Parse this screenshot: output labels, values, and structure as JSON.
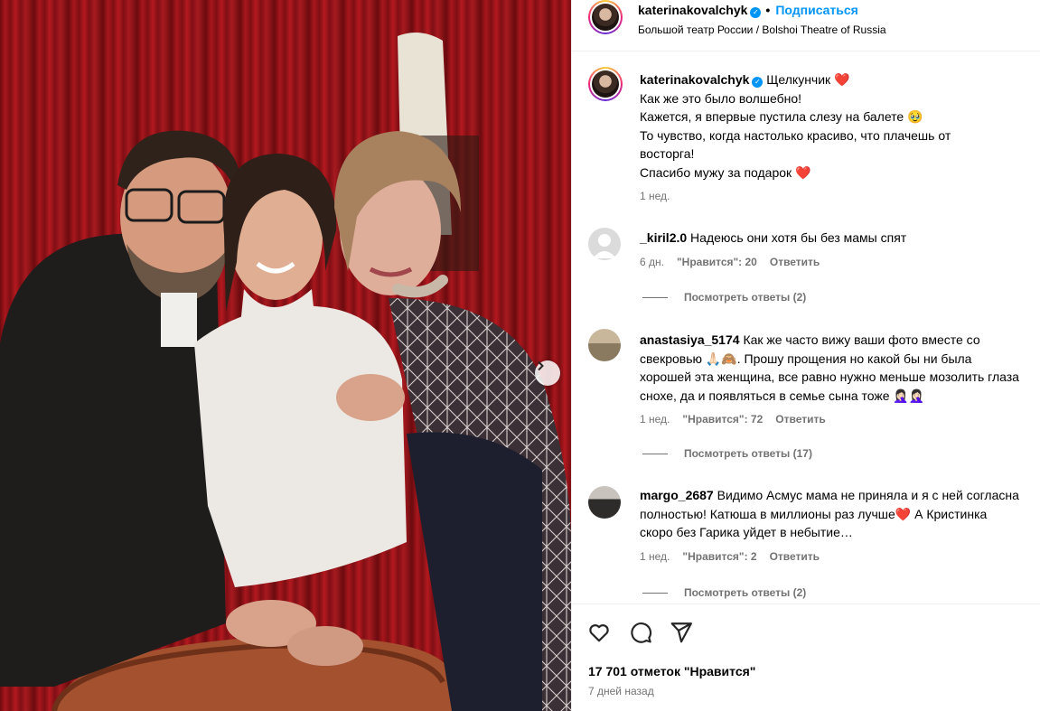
{
  "header": {
    "username": "katerinakovalchyk",
    "follow_label": "Подписаться",
    "dot": "•",
    "location": "Большой театр России / Bolshoi Theatre of Russia"
  },
  "caption": {
    "username": "katerinakovalchyk",
    "lines": [
      "Щелкунчик ❤️",
      "Как же это было волшебно!",
      "Кажется, я впервые пустила слезу на балете 🥹",
      "То чувство, когда настолько красиво, что плачешь от восторга!",
      "Спасибо мужу за подарок ❤️"
    ],
    "time": "1 нед."
  },
  "comments": [
    {
      "username": "_kiril2.0",
      "text": "Надеюсь они хотя бы без мамы спят",
      "time": "6 дн.",
      "likes": "\"Нравится\": 20",
      "reply": "Ответить",
      "view_replies": "Посмотреть ответы (2)"
    },
    {
      "username": "anastasiya_5174",
      "text": "Как же часто вижу ваши фото вместе со свекровью 🙏🏻🙈. Прошу прощения но какой бы ни была хорошей эта женщина, все равно нужно меньше мозолить глаза снохе, да и появляться в семье сына тоже 🤦🏻‍♀️🤦🏻‍♀️",
      "time": "1 нед.",
      "likes": "\"Нравится\": 72",
      "reply": "Ответить",
      "view_replies": "Посмотреть ответы (17)"
    },
    {
      "username": "margo_2687",
      "text": "Видимо Асмус мама не приняла и я с ней согласна полностью! Катюша в миллионы раз лучше❤️ А Кристинка скоро без Гарика уйдет в небытие…",
      "time": "1 нед.",
      "likes": "\"Нравится\": 2",
      "reply": "Ответить",
      "view_replies": "Посмотреть ответы (2)"
    }
  ],
  "footer": {
    "likes": "17 701 отметок \"Нравится\"",
    "posted": "7 дней назад"
  },
  "icons": {
    "like": "heart-outline-icon",
    "comment": "comment-bubble-icon",
    "share": "paper-plane-icon",
    "carousel_next": "chevron-right-icon"
  },
  "colors": {
    "accent": "#0095f6",
    "muted": "#737373",
    "like_red": "#ed4956"
  }
}
